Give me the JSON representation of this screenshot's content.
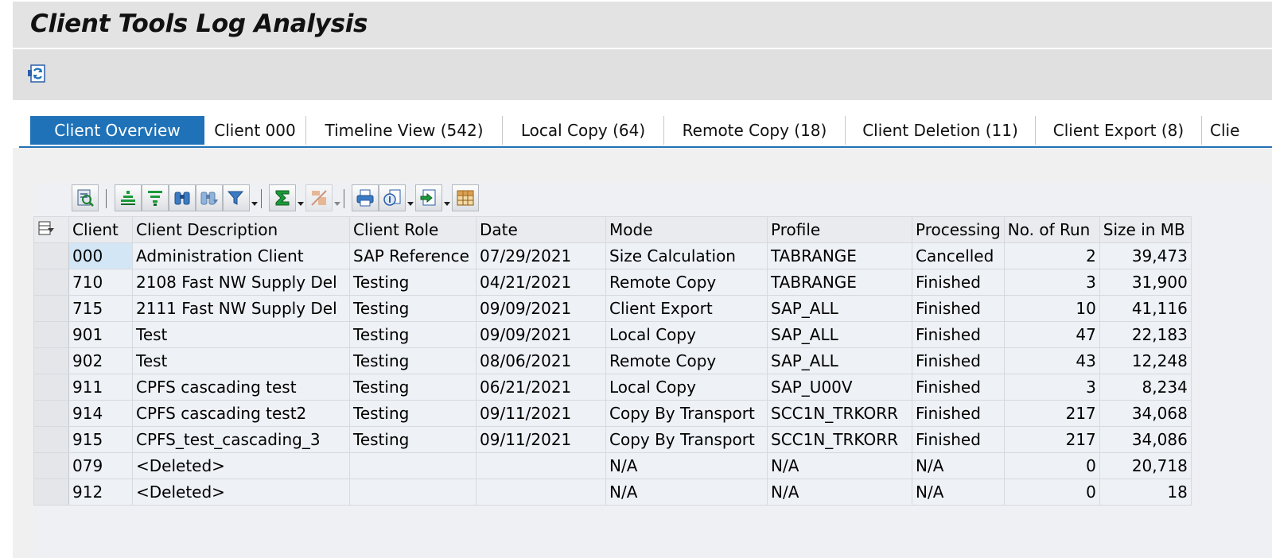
{
  "window": {
    "title": "Client Tools Log Analysis"
  },
  "appbar": {
    "refresh_icon": "refresh-icon"
  },
  "tabs": [
    {
      "label": "Client Overview",
      "active": true
    },
    {
      "label": "Client 000"
    },
    {
      "label": "Timeline View (542)"
    },
    {
      "label": "Local Copy (64)"
    },
    {
      "label": "Remote Copy (18)"
    },
    {
      "label": "Client Deletion (11)"
    },
    {
      "label": "Client Export (8)"
    },
    {
      "label": "Clie"
    }
  ],
  "toolbar": {
    "buttons": [
      "details-icon",
      "sort-ascending-icon",
      "sort-descending-icon",
      "find-icon",
      "find-next-icon",
      "filter-icon",
      "sum-icon",
      "subtotal-icon",
      "print-icon",
      "view-icon",
      "export-icon",
      "layout-icon"
    ]
  },
  "colors": {
    "accent": "#1f72b8",
    "selected_cell": "#d3e6f5"
  },
  "table": {
    "columns": [
      "Client",
      "Client Description",
      "Client Role",
      "Date",
      "Mode",
      "Profile",
      "Processing",
      "No. of Run",
      "Size in MB"
    ],
    "rows": [
      [
        "000",
        "Administration Client",
        "SAP Reference",
        "07/29/2021",
        "Size Calculation",
        "TABRANGE",
        "Cancelled",
        "2",
        "39,473"
      ],
      [
        "710",
        "2108 Fast NW Supply Del",
        "Testing",
        "04/21/2021",
        "Remote Copy",
        "TABRANGE",
        "Finished",
        "3",
        "31,900"
      ],
      [
        "715",
        "2111 Fast NW Supply Del",
        "Testing",
        "09/09/2021",
        "Client Export",
        "SAP_ALL",
        "Finished",
        "10",
        "41,116"
      ],
      [
        "901",
        "Test",
        "Testing",
        "09/09/2021",
        "Local Copy",
        "SAP_ALL",
        "Finished",
        "47",
        "22,183"
      ],
      [
        "902",
        "Test",
        "Testing",
        "08/06/2021",
        "Remote Copy",
        "SAP_ALL",
        "Finished",
        "43",
        "12,248"
      ],
      [
        "911",
        "CPFS cascading test",
        "Testing",
        "06/21/2021",
        "Local Copy",
        "SAP_U00V",
        "Finished",
        "3",
        "8,234"
      ],
      [
        "914",
        "CPFS cascading test2",
        "Testing",
        "09/11/2021",
        "Copy By Transport",
        "SCC1N_TRKORR",
        "Finished",
        "217",
        "34,068"
      ],
      [
        "915",
        "CPFS_test_cascading_3",
        "Testing",
        "09/11/2021",
        "Copy By Transport",
        "SCC1N_TRKORR",
        "Finished",
        "217",
        "34,086"
      ],
      [
        "079",
        "<Deleted>",
        "",
        "",
        "N/A",
        "N/A",
        "N/A",
        "0",
        "20,718"
      ],
      [
        "912",
        "<Deleted>",
        "",
        "",
        "N/A",
        "N/A",
        "N/A",
        "0",
        "18"
      ]
    ]
  }
}
